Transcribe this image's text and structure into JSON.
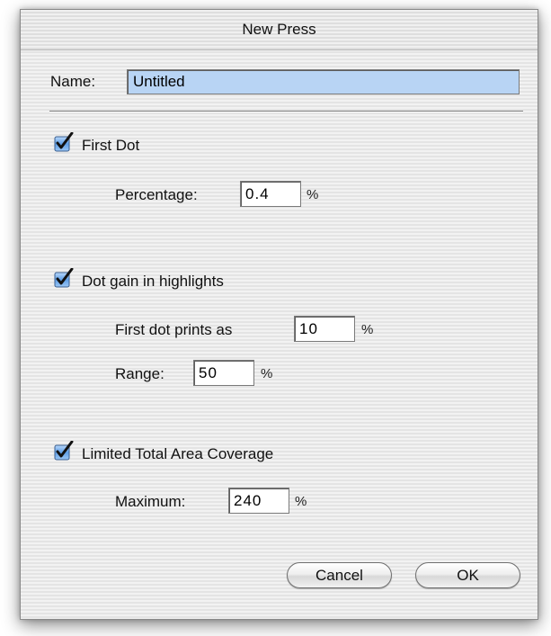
{
  "window": {
    "title": "New Press"
  },
  "name": {
    "label": "Name:",
    "value": "Untitled"
  },
  "first_dot": {
    "checkbox_label": "First Dot",
    "checked": true,
    "percentage_label": "Percentage:",
    "percentage_value": "0.4",
    "unit": "%"
  },
  "dot_gain": {
    "checkbox_label": "Dot gain in highlights",
    "checked": true,
    "first_dot_label": "First dot prints as",
    "first_dot_value": "10",
    "first_dot_unit": "%",
    "range_label": "Range:",
    "range_value": "50",
    "range_unit": "%"
  },
  "tac": {
    "checkbox_label": "Limited Total Area Coverage",
    "checked": true,
    "maximum_label": "Maximum:",
    "maximum_value": "240",
    "unit": "%"
  },
  "buttons": {
    "cancel": "Cancel",
    "ok": "OK"
  },
  "colors": {
    "checkbox_accent": "#3d7fd6",
    "selection": "#b8d4f4"
  },
  "icons": {
    "checkbox": "checkmark-icon"
  }
}
